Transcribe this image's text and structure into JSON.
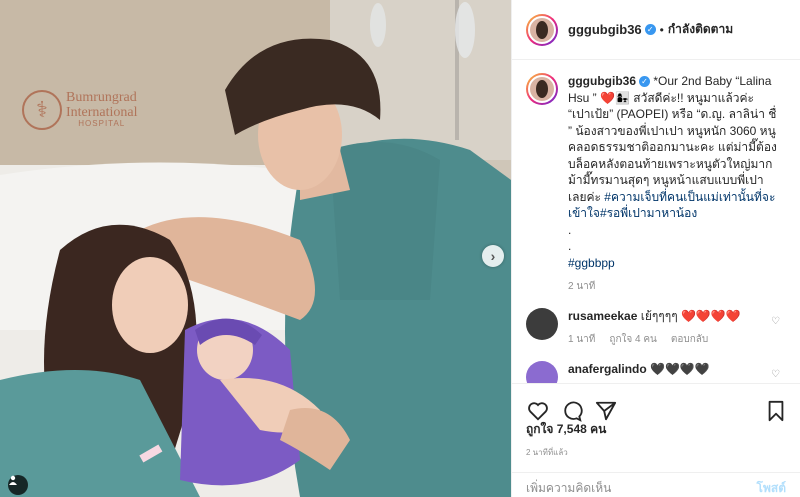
{
  "photo": {
    "logo_line1": "Bumrungrad",
    "logo_line2": "International",
    "logo_line3": "HOSPITAL",
    "next_icon": "chevron-right-icon",
    "tag_icon": "user-tag-icon"
  },
  "header": {
    "username": "gggubgib36",
    "follow_label": "กำลังติดตาม",
    "separator": "•"
  },
  "caption": {
    "username": "gggubgib36",
    "text_part1": " *Our 2nd Baby “Lalina Hsu ” ",
    "heart": "❤️",
    "emoji": "👩‍👧",
    "text_part2": " สวัสดีค่ะ!! หนูมาแล้วค่ะ “เปาเป้ย” (PAOPEI) หรือ “ด.ญ. ลาลิน่า ชื่ ” น้องสาวของพี่เปาเปา หนูหนัก 3060 หนูคลอดธรรมชาติออกมานะคะ แต่ม่ามี๊ต้องบล็อคหลังตอนท้ายเพราะหนูตัวใหญ่มากม้ามี๊ทรมานสุดๆ หนูหน้าแสบแบบพี่เปาเลยค่ะ ",
    "hashtag1": "#ความเจ็บที่คนเป็นแม่เท่านั้นที่จะเข้าใจ",
    "hashtag2": "#รอพี่เปามาหาน้อง",
    "dot1": ".",
    "dot2": ".",
    "hashtag3": "#ggbbpp",
    "time": "2 นาที"
  },
  "comments": [
    {
      "username": "rusameekae",
      "text": " เย้ๆๆๆๆ ",
      "hearts": "❤️❤️❤️❤️",
      "time": "1 นาที",
      "likes": "ถูกใจ 4 คน",
      "reply": "ตอบกลับ"
    },
    {
      "username": "anafergalindo",
      "text": " 🖤🖤🖤🖤"
    }
  ],
  "actions": {
    "like_icon": "heart-icon",
    "comment_icon": "comment-icon",
    "share_icon": "share-icon",
    "save_icon": "bookmark-icon"
  },
  "likes_label": "ถูกใจ 7,548 คน",
  "post_time": "2 นาทีที่แล้ว",
  "add_comment": {
    "placeholder": "เพิ่มความคิดเห็น",
    "post_label": "โพสต์"
  },
  "colors": {
    "link": "#003569",
    "verified": "#3897f0",
    "heart": "#ed1c24",
    "post_disabled": "#b2dffc"
  }
}
